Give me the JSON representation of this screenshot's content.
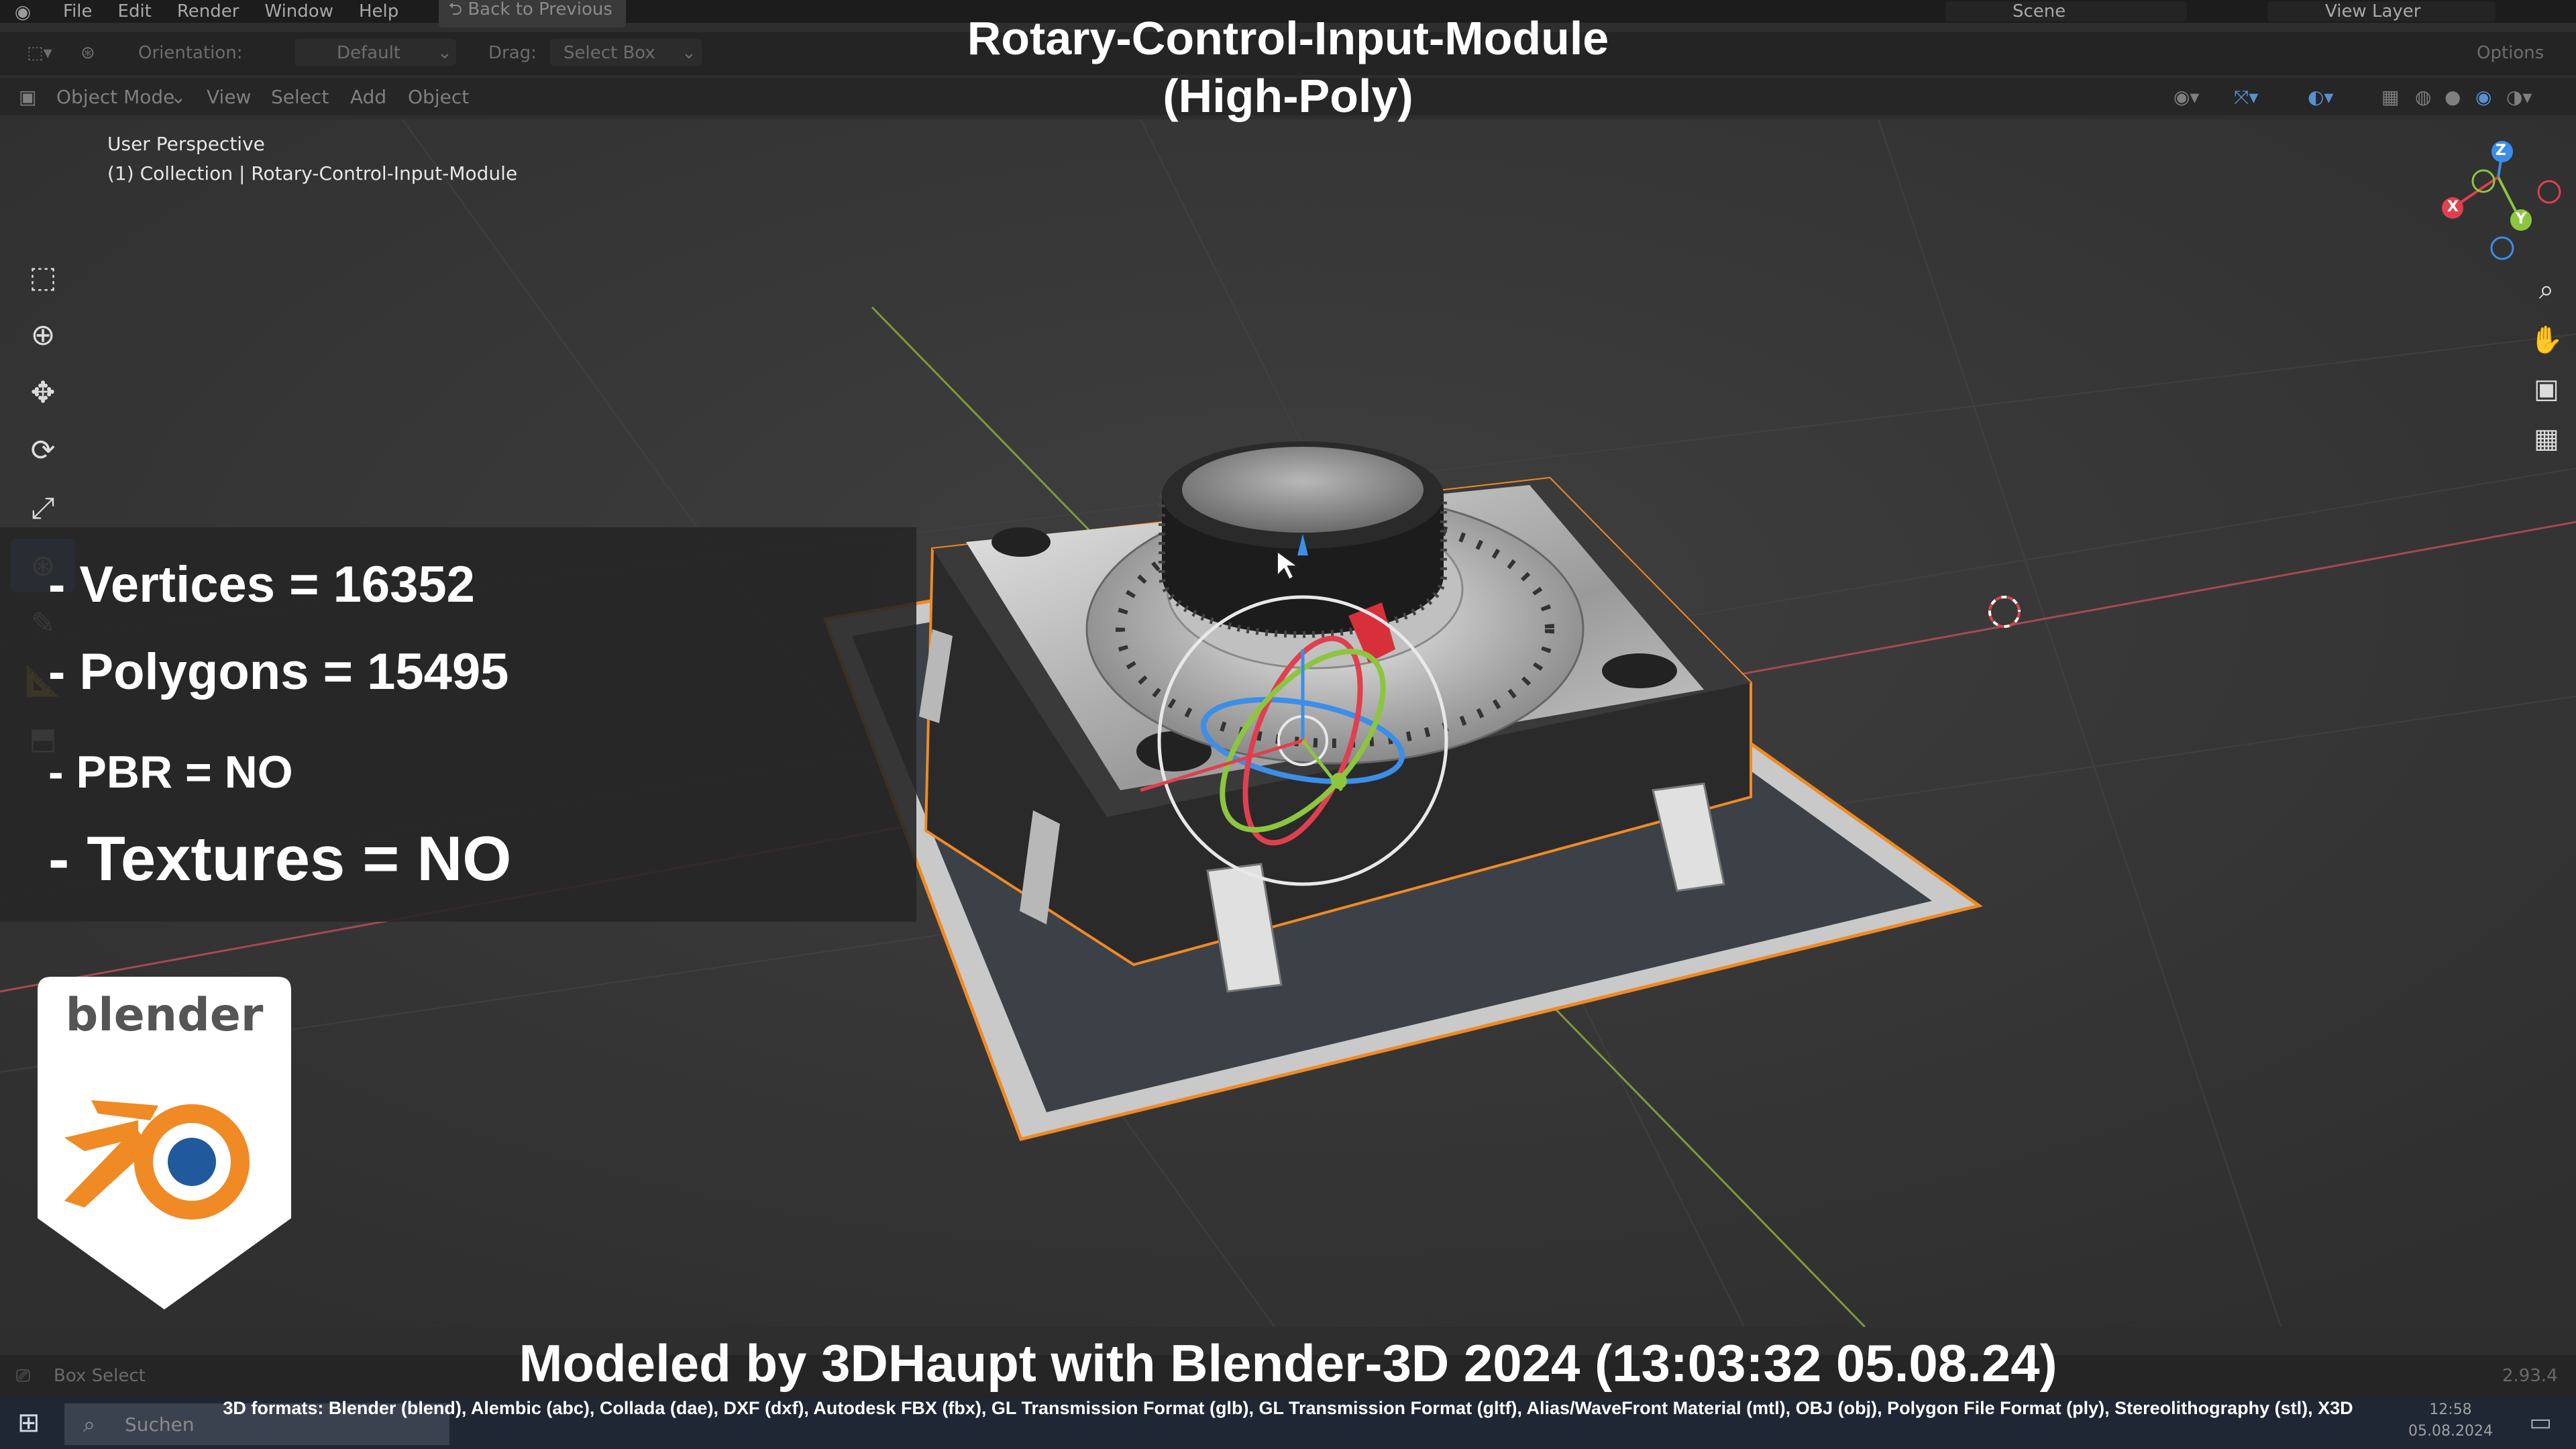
{
  "menubar": {
    "items": [
      "File",
      "Edit",
      "Render",
      "Window",
      "Help"
    ],
    "back_button": "Back to Previous",
    "scene": "Scene",
    "view_layer": "View Layer"
  },
  "toolheader": {
    "orientation_label": "Orientation:",
    "orientation_value": "Default",
    "drag_label": "Drag:",
    "drag_value": "Select Box",
    "options": "Options"
  },
  "viewheader": {
    "mode": "Object Mode",
    "items": [
      "View",
      "Select",
      "Add",
      "Object"
    ]
  },
  "viewport": {
    "perspective": "User Perspective",
    "collection": "(1) Collection | Rotary-Control-Input-Module"
  },
  "overlay": {
    "title_line1": "Rotary-Control-Input-Module",
    "title_line2": "(High-Poly)",
    "stats": {
      "vertices": "- Vertices = 16352",
      "polygons": "- Polygons = 15495",
      "pbr": "- PBR =  NO",
      "textures": "- Textures = NO"
    },
    "logo_text": "blender",
    "credits": "Modeled by 3DHaupt with Blender-3D 2024 (13:03:32  05.08.24)",
    "formats": "3D formats: Blender (blend), Alembic (abc), Collada (dae), DXF (dxf), Autodesk FBX (fbx), GL Transmission Format (glb), GL Transmission Format (gltf), Alias/WaveFront Material (mtl), OBJ (obj), Polygon File Format (ply), Stereolithography (stl), X3D"
  },
  "statusbar": {
    "left": "Box Select",
    "version": "2.93.4"
  },
  "taskbar": {
    "search_placeholder": "Suchen",
    "time": "12:58",
    "date": "05.08.2024"
  },
  "gizmo": {
    "x": "X",
    "y": "Y",
    "z": "Z"
  },
  "colors": {
    "accent_orange": "#f08a24",
    "active_tool": "#4a76ad",
    "axis_x": "#e0404e",
    "axis_y": "#8cc63f",
    "axis_z": "#3c8ee8"
  }
}
